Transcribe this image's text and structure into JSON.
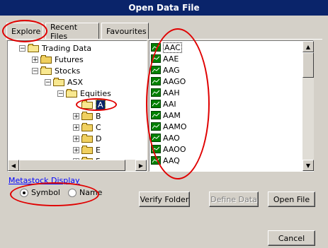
{
  "window": {
    "title": "Open Data File"
  },
  "tabs": [
    {
      "label": "Explore",
      "active": true
    },
    {
      "label": "Recent Files",
      "active": false
    },
    {
      "label": "Favourites",
      "active": false
    }
  ],
  "tree": {
    "items": [
      {
        "label": "Trading Data",
        "expander": "−",
        "level": 1
      },
      {
        "label": "Futures",
        "expander": "+",
        "level": 2
      },
      {
        "label": "Stocks",
        "expander": "−",
        "level": 2
      },
      {
        "label": "ASX",
        "expander": "−",
        "level": 3
      },
      {
        "label": "Equities",
        "expander": "−",
        "level": 4
      },
      {
        "label": "A",
        "expander": "",
        "level": 5,
        "selected": true
      },
      {
        "label": "B",
        "expander": "+",
        "level": 5
      },
      {
        "label": "C",
        "expander": "+",
        "level": 5
      },
      {
        "label": "D",
        "expander": "+",
        "level": 5
      },
      {
        "label": "E",
        "expander": "+",
        "level": 5
      },
      {
        "label": "F",
        "expander": "+",
        "level": 5
      }
    ]
  },
  "files": {
    "items": [
      "AAC",
      "AAE",
      "AAG",
      "AAGO",
      "AAH",
      "AAI",
      "AAM",
      "AAMO",
      "AAO",
      "AAOO",
      "AAQ"
    ],
    "selected_index": 0
  },
  "display": {
    "label": "Metastock Display",
    "options": [
      {
        "label": "Symbol",
        "checked": true
      },
      {
        "label": "Name",
        "checked": false
      }
    ]
  },
  "buttons": {
    "verify": "Verify Folder",
    "define": "Define Data",
    "open": "Open File",
    "cancel": "Cancel"
  },
  "colors": {
    "titlebar": "#0a246a",
    "annotation": "#e00000",
    "link": "#0000ff"
  }
}
